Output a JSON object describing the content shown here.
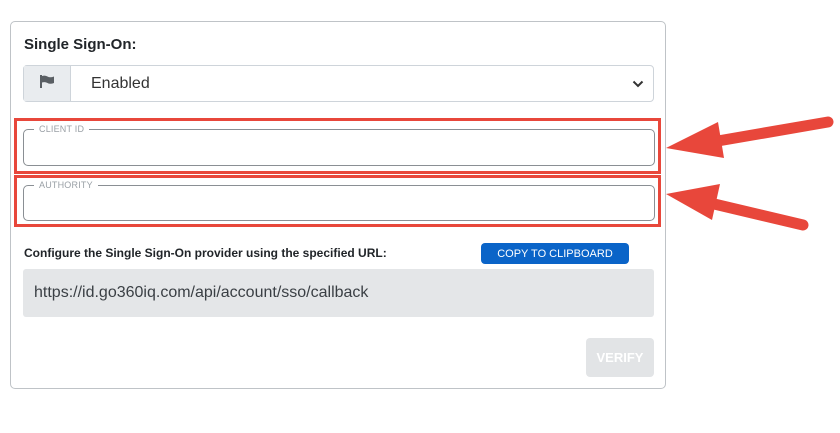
{
  "sso": {
    "title": "Single Sign-On:",
    "select": {
      "value": "Enabled",
      "icon": "flag-icon"
    },
    "client_id": {
      "legend": "CLIENT ID",
      "value": ""
    },
    "authority": {
      "legend": "AUTHORITY",
      "value": ""
    },
    "config_label": "Configure the Single Sign-On provider using the specified URL:",
    "copy_button": "COPY TO CLIPBOARD",
    "callback_url": "https://id.go360iq.com/api/account/sso/callback",
    "verify_button": "VERIFY"
  },
  "colors": {
    "accent": "#0a64c8",
    "highlight": "#e8473b",
    "url_background": "#e4e6e8",
    "disabled_button": "#e2e4e6"
  }
}
